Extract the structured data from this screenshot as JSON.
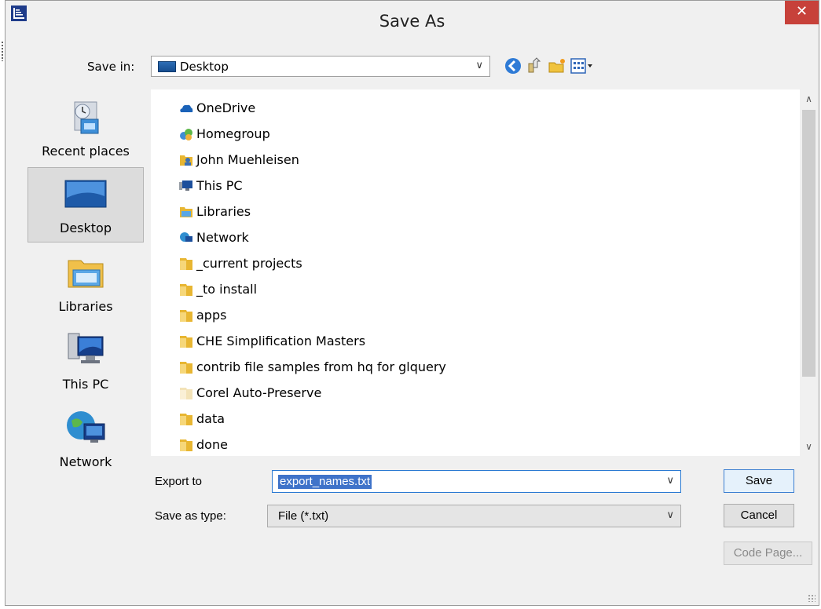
{
  "window": {
    "title": "Save As",
    "close_symbol": "✕"
  },
  "toolbar": {
    "save_in_label": "Save in:",
    "save_in_value": "Desktop",
    "dropdown_symbol": "∨"
  },
  "places": [
    {
      "label": "Recent places",
      "icon": "recent-places-icon"
    },
    {
      "label": "Desktop",
      "icon": "desktop-icon",
      "selected": true
    },
    {
      "label": "Libraries",
      "icon": "libraries-icon"
    },
    {
      "label": "This PC",
      "icon": "this-pc-icon"
    },
    {
      "label": "Network",
      "icon": "network-icon"
    }
  ],
  "files": [
    {
      "name": "OneDrive",
      "icon": "onedrive-icon"
    },
    {
      "name": "Homegroup",
      "icon": "homegroup-icon"
    },
    {
      "name": "John Muehleisen",
      "icon": "user-folder-icon"
    },
    {
      "name": "This PC",
      "icon": "this-pc-icon"
    },
    {
      "name": "Libraries",
      "icon": "libraries-icon"
    },
    {
      "name": "Network",
      "icon": "network-icon"
    },
    {
      "name": "_current projects",
      "icon": "folder-icon"
    },
    {
      "name": "_to install",
      "icon": "folder-icon"
    },
    {
      "name": "apps",
      "icon": "folder-icon"
    },
    {
      "name": "CHE Simplification Masters",
      "icon": "folder-icon"
    },
    {
      "name": "contrib file samples from hq for glquery",
      "icon": "folder-icon"
    },
    {
      "name": "Corel Auto-Preserve",
      "icon": "folder-faded-icon"
    },
    {
      "name": "data",
      "icon": "folder-icon"
    },
    {
      "name": "done",
      "icon": "folder-icon"
    }
  ],
  "scroll": {
    "up_symbol": "∧",
    "down_symbol": "∨"
  },
  "form": {
    "export_label": "Export to",
    "export_value": "export_names.txt",
    "type_label": "Save as type:",
    "type_value": "File (*.txt)"
  },
  "buttons": {
    "save": "Save",
    "cancel": "Cancel",
    "code_page": "Code Page..."
  },
  "colors": {
    "close_red": "#c7413a",
    "selection_blue": "#3f73c9",
    "folder_yellow": "#e8b632"
  }
}
